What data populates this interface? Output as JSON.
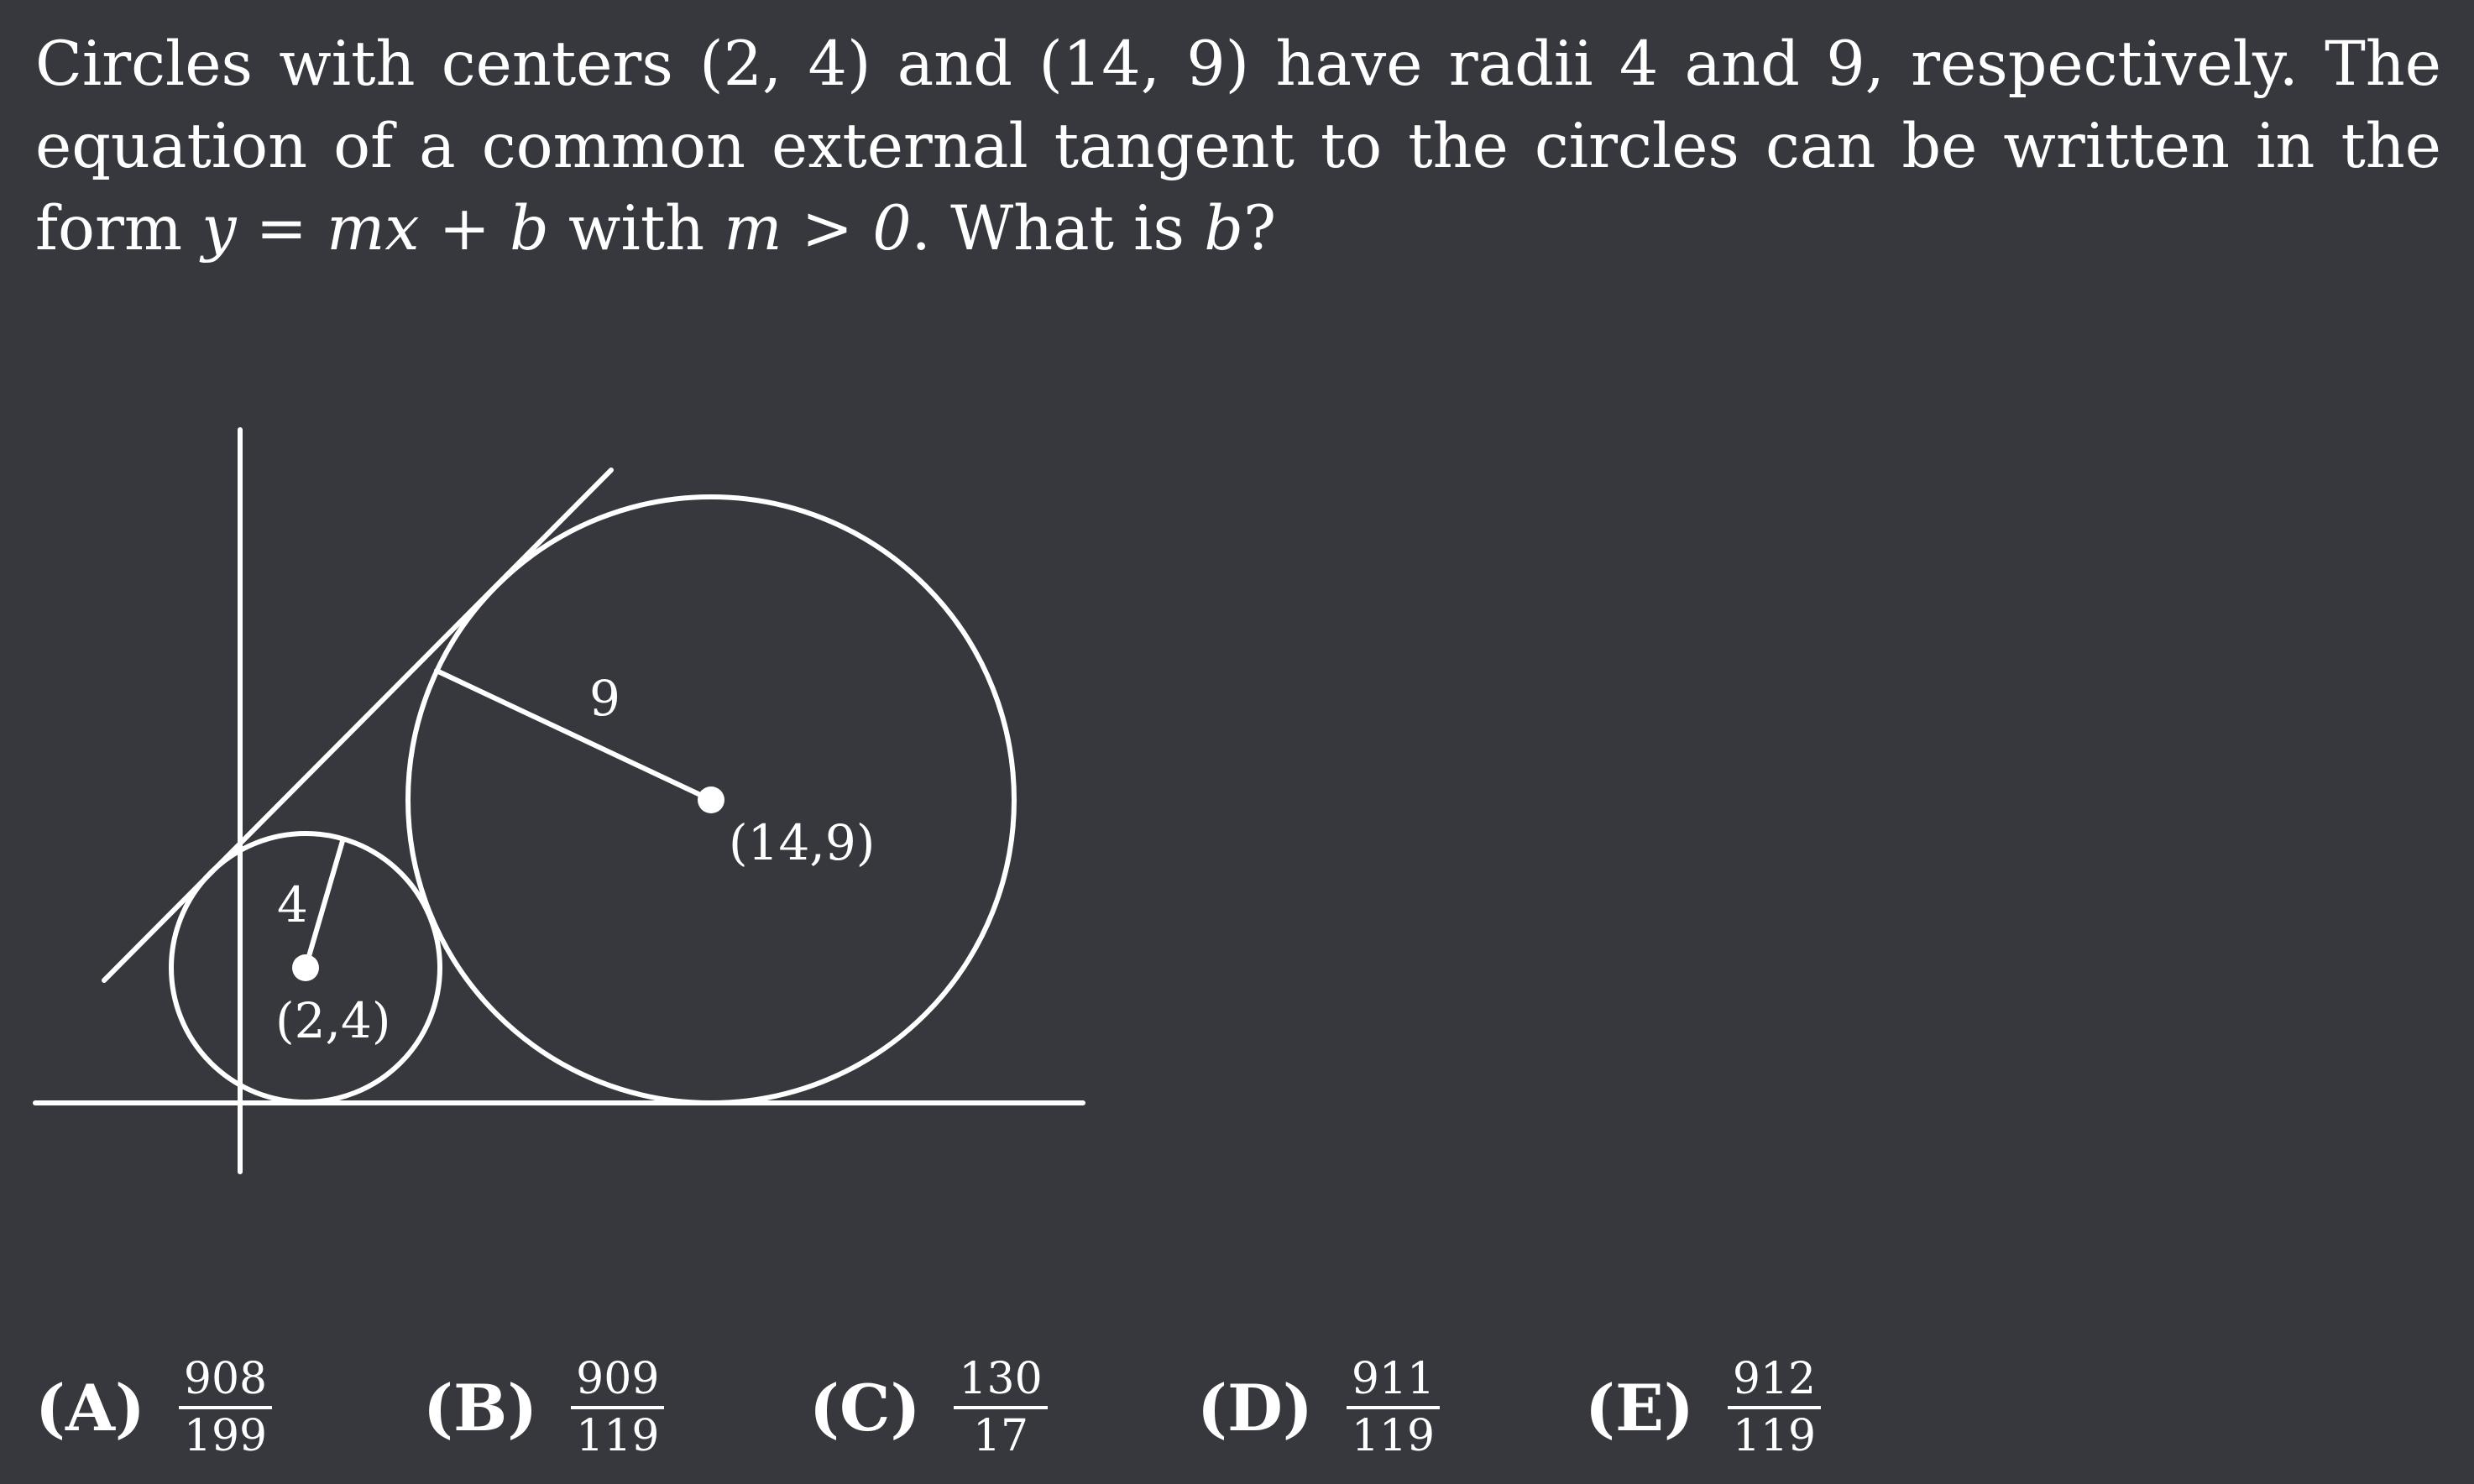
{
  "problem": {
    "p1": "Circles with centers (2, 4) and (14, 9) have radii 4 and 9, respectively. The equation of a common external tangent to the circles can be written in the form ",
    "eq": "y = mx + b",
    "p2": " with ",
    "cond": "m > 0",
    "p3": ". What is ",
    "var_b": "b",
    "p4": "?"
  },
  "figure": {
    "small_radius_label": "4",
    "large_radius_label": "9",
    "small_center_label": "(2,4)",
    "large_center_label": "(14,9)",
    "stroke_color": "#ffffff",
    "background_color": "#36383d"
  },
  "choices": [
    {
      "letter": "(A)",
      "num": "908",
      "den": "199"
    },
    {
      "letter": "(B)",
      "num": "909",
      "den": "119"
    },
    {
      "letter": "(C)",
      "num": "130",
      "den": "17"
    },
    {
      "letter": "(D)",
      "num": "911",
      "den": "119"
    },
    {
      "letter": "(E)",
      "num": "912",
      "den": "119"
    }
  ]
}
